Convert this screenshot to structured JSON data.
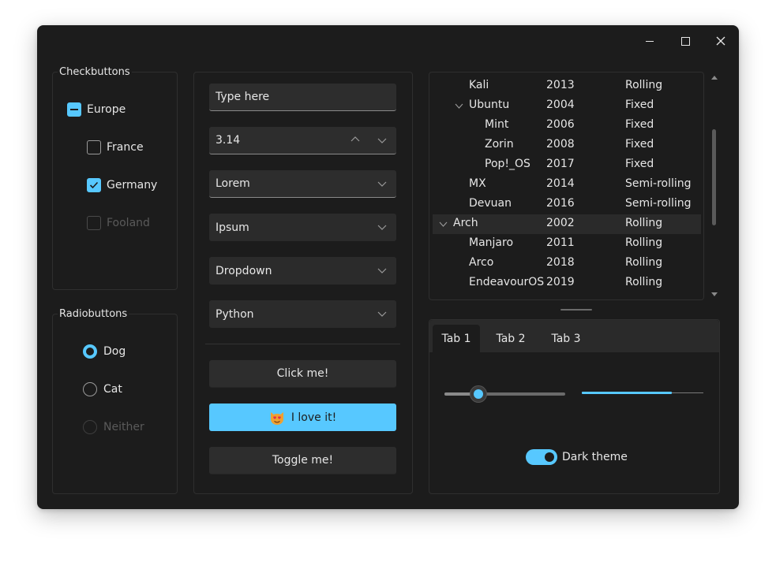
{
  "colors": {
    "accent": "#57c8ff",
    "window_bg": "#1c1c1c",
    "field_bg": "#2d2d2d"
  },
  "window": {
    "controls": [
      "minimize-icon",
      "maximize-icon",
      "close-icon"
    ]
  },
  "checkbuttons": {
    "title": "Checkbuttons",
    "items": [
      {
        "label": "Europe",
        "state": "indeterminate"
      },
      {
        "label": "France",
        "state": "unchecked"
      },
      {
        "label": "Germany",
        "state": "checked"
      },
      {
        "label": "Fooland",
        "state": "disabled"
      }
    ]
  },
  "radiobuttons": {
    "title": "Radiobuttons",
    "items": [
      {
        "label": "Dog",
        "state": "selected"
      },
      {
        "label": "Cat",
        "state": "unselected"
      },
      {
        "label": "Neither",
        "state": "disabled"
      }
    ]
  },
  "inputs": {
    "entry_value": "Type here",
    "spinbox_value": "3.14",
    "combo1_value": "Lorem",
    "combo2_value": "Ipsum",
    "dropdown_value": "Dropdown",
    "option_value": "Python"
  },
  "buttons": {
    "click_label": "Click me!",
    "love_label": "I love it!",
    "toggle_label": "Toggle me!"
  },
  "tree": {
    "rows": [
      {
        "name": "Kali",
        "year": "2013",
        "type": "Rolling",
        "level": 1
      },
      {
        "name": "Ubuntu",
        "year": "2004",
        "type": "Fixed",
        "level": 1,
        "expanded": true
      },
      {
        "name": "Mint",
        "year": "2006",
        "type": "Fixed",
        "level": 2
      },
      {
        "name": "Zorin",
        "year": "2008",
        "type": "Fixed",
        "level": 2
      },
      {
        "name": "Pop!_OS",
        "year": "2017",
        "type": "Fixed",
        "level": 2
      },
      {
        "name": "MX",
        "year": "2014",
        "type": "Semi-rolling",
        "level": 1
      },
      {
        "name": "Devuan",
        "year": "2016",
        "type": "Semi-rolling",
        "level": 1
      },
      {
        "name": "Arch",
        "year": "2002",
        "type": "Rolling",
        "level": 0,
        "expanded": true,
        "selected": true
      },
      {
        "name": "Manjaro",
        "year": "2011",
        "type": "Rolling",
        "level": 1
      },
      {
        "name": "Arco",
        "year": "2018",
        "type": "Rolling",
        "level": 1
      },
      {
        "name": "EndeavourOS",
        "year": "2019",
        "type": "Rolling",
        "level": 1
      }
    ]
  },
  "notebook": {
    "tabs": [
      "Tab 1",
      "Tab 2",
      "Tab 3"
    ],
    "active_tab": 0,
    "slider_value": 0.28,
    "progress_value": 0.74,
    "switch_label": "Dark theme",
    "switch_on": true
  }
}
